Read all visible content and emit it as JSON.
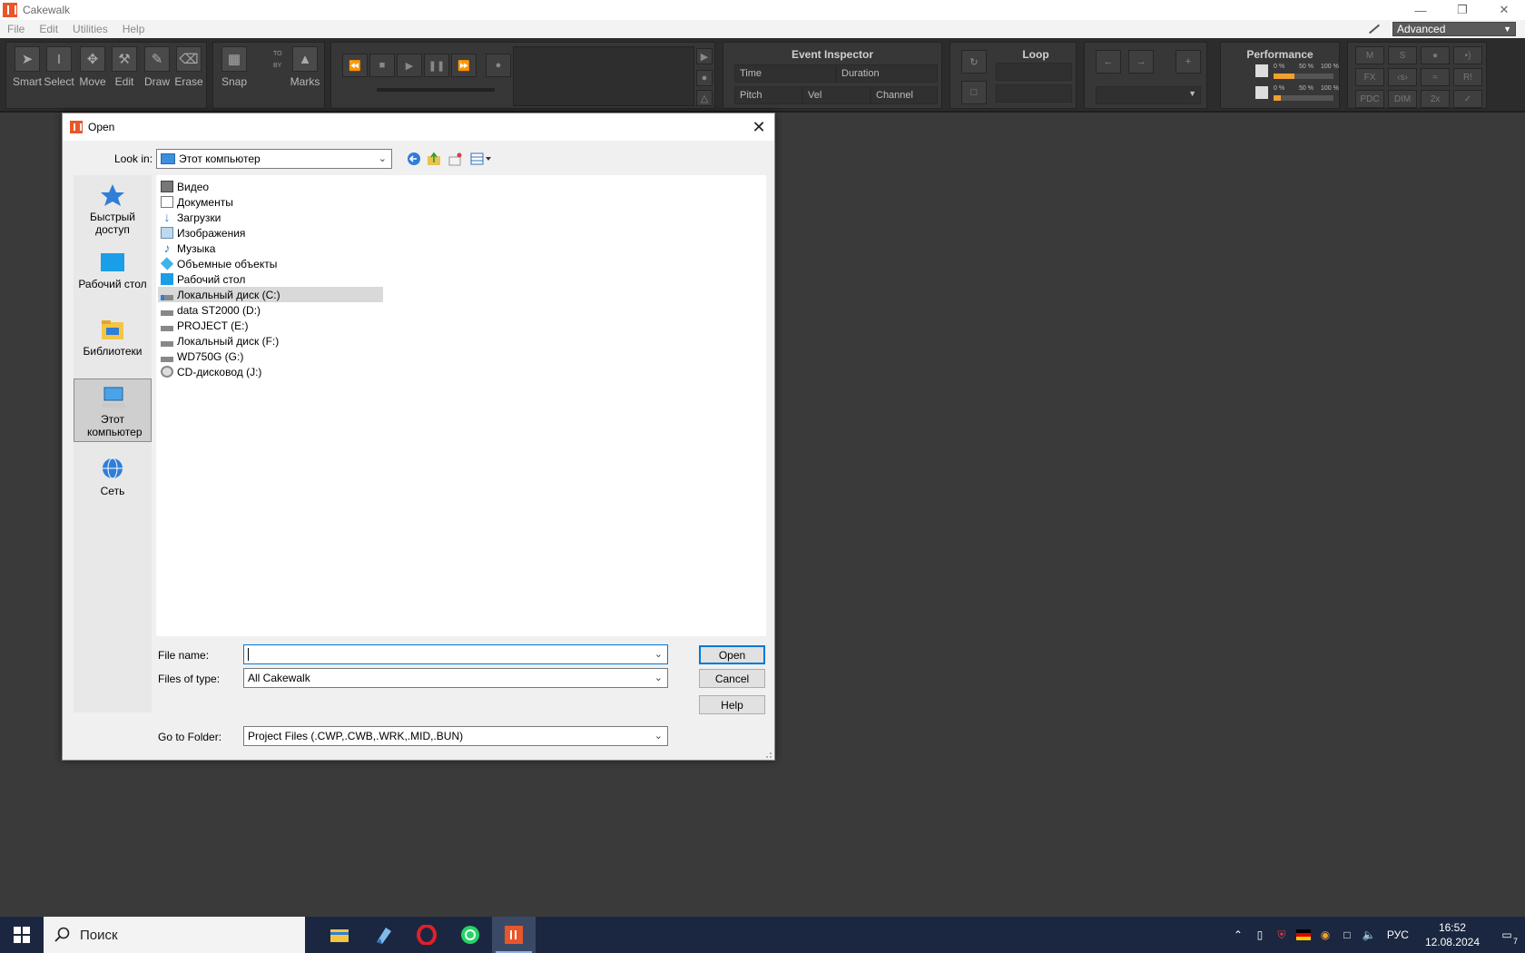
{
  "app": {
    "title": "Cakewalk"
  },
  "menu": {
    "items": [
      "File",
      "Edit",
      "Utilities",
      "Help"
    ],
    "workspace": "Advanced"
  },
  "control_bar": {
    "tools": [
      "Smart",
      "Select",
      "Move",
      "Edit",
      "Draw",
      "Erase"
    ],
    "snap_label": "Snap",
    "snap_to": "TO",
    "snap_by": "BY",
    "marks_label": "Marks",
    "event_inspector": {
      "title": "Event Inspector",
      "time": "Time",
      "duration": "Duration",
      "pitch": "Pitch",
      "vel": "Vel",
      "channel": "Channel"
    },
    "loop_title": "Loop",
    "performance": {
      "title": "Performance",
      "scale": [
        "0 %",
        "50 %",
        "100 %"
      ],
      "cpu_level": 0.35,
      "disk_level": 0.12
    },
    "mix": {
      "m": "M",
      "s": "S",
      "fx": "FX",
      "pdc": "PDC",
      "dim": "DIM",
      "x2": "2x",
      "r": "R!"
    }
  },
  "dialog": {
    "title": "Open",
    "look_in_label": "Look in:",
    "look_in_value": "Этот компьютер",
    "places": [
      "Быстрый доступ",
      "Рабочий стол",
      "Библиотеки",
      "Этот компьютер",
      "Сеть"
    ],
    "files": [
      {
        "name": "Видео",
        "icon": "video-folder-icon"
      },
      {
        "name": "Документы",
        "icon": "documents-folder-icon"
      },
      {
        "name": "Загрузки",
        "icon": "downloads-folder-icon"
      },
      {
        "name": "Изображения",
        "icon": "pictures-folder-icon"
      },
      {
        "name": "Музыка",
        "icon": "music-folder-icon"
      },
      {
        "name": "Объемные объекты",
        "icon": "3d-objects-folder-icon"
      },
      {
        "name": "Рабочий стол",
        "icon": "desktop-folder-icon"
      },
      {
        "name": "Локальный диск (C:)",
        "icon": "system-drive-icon"
      },
      {
        "name": "data ST2000 (D:)",
        "icon": "drive-icon"
      },
      {
        "name": "PROJECT (E:)",
        "icon": "drive-icon"
      },
      {
        "name": "Локальный диск (F:)",
        "icon": "drive-icon"
      },
      {
        "name": "WD750G (G:)",
        "icon": "drive-icon"
      },
      {
        "name": "CD-дисковод (J:)",
        "icon": "cd-drive-icon"
      }
    ],
    "file_name_label": "File name:",
    "file_name_value": "",
    "files_of_type_label": "Files of type:",
    "files_of_type_value": "All Cakewalk",
    "go_to_folder_label": "Go to Folder:",
    "go_to_folder_value": "Project Files (.CWP,.CWB,.WRK,.MID,.BUN)",
    "open_btn": "Open",
    "cancel_btn": "Cancel",
    "help_btn": "Help"
  },
  "taskbar": {
    "search_placeholder": "Поиск",
    "lang": "РУС",
    "time": "16:52",
    "date": "12.08.2024",
    "notifications": "7"
  }
}
